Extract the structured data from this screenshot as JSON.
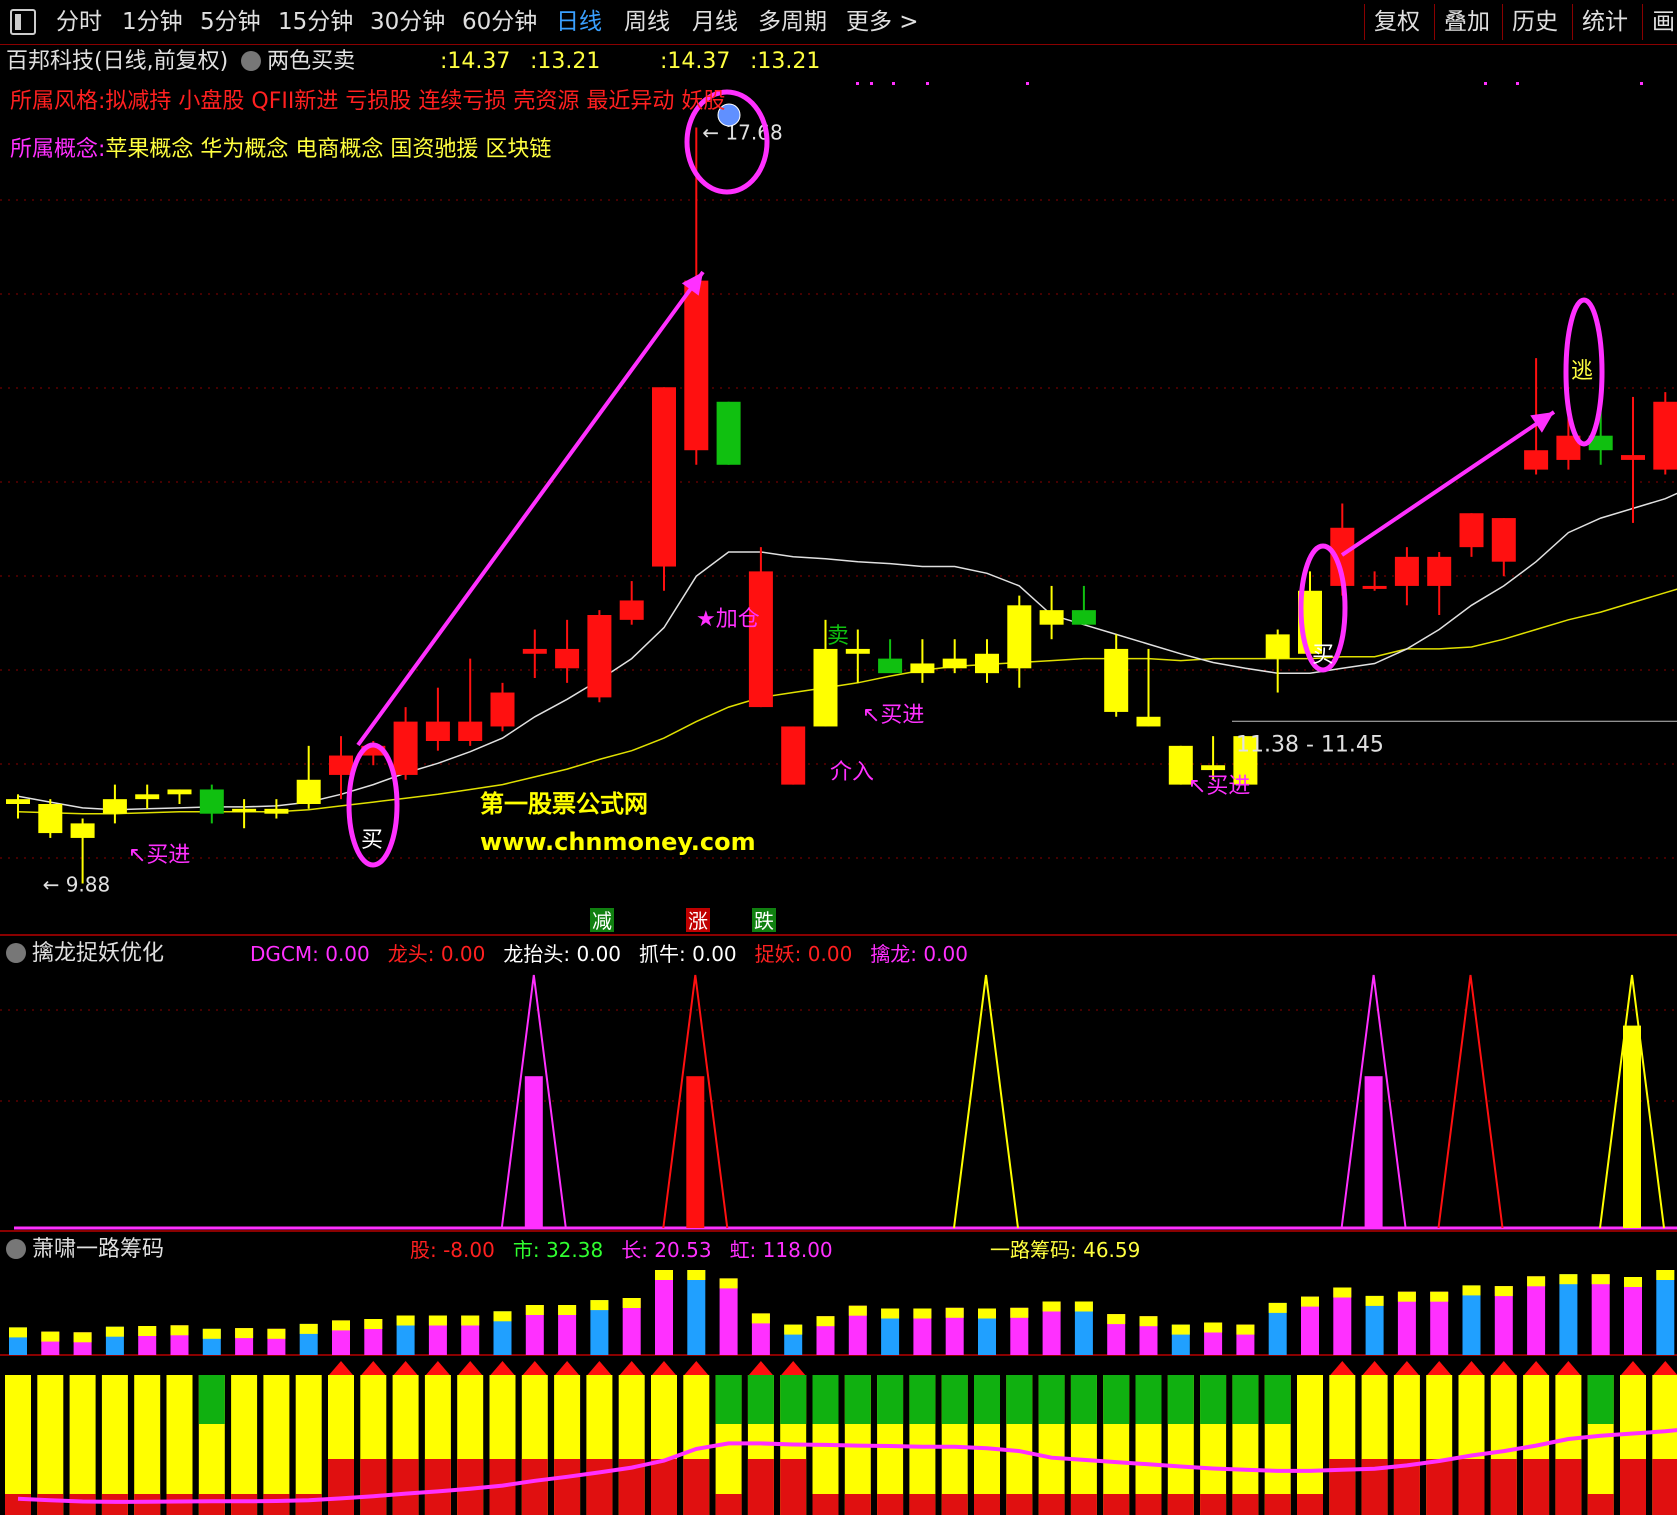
{
  "toolbar": {
    "periods": [
      {
        "label": "分时",
        "active": false
      },
      {
        "label": "1分钟",
        "active": false
      },
      {
        "label": "5分钟",
        "active": false
      },
      {
        "label": "15分钟",
        "active": false
      },
      {
        "label": "30分钟",
        "active": false
      },
      {
        "label": "60分钟",
        "active": false
      },
      {
        "label": "日线",
        "active": true
      },
      {
        "label": "周线",
        "active": false
      },
      {
        "label": "月线",
        "active": false
      },
      {
        "label": "多周期",
        "active": false
      },
      {
        "label": "更多 >",
        "active": false
      }
    ],
    "right": [
      "复权",
      "叠加",
      "历史",
      "统计",
      "画"
    ]
  },
  "main": {
    "title": "百邦科技(日线,前复权)",
    "indicator": "两色买卖",
    "values": [
      ":14.37",
      ":13.21",
      ":14.37",
      ":13.21"
    ],
    "style_label": "所属风格:",
    "style_text": "拟减持 小盘股 QFII新进 亏损股 连续亏损 壳资源 最近异动 妖股",
    "concept_label": "所属概念:",
    "concept_text": "苹果概念 华为概念 电商概念 国资驰援 区块链",
    "watermark_1": "第一股票公式网",
    "watermark_2": "www.chnmoney.com",
    "high_label": "17.68",
    "low_label": "9.88",
    "range_box": "11.38 - 11.45",
    "markers": {
      "buy": "买",
      "buy_in": "买进",
      "sell": "卖",
      "enter": "介入",
      "escape": "逃",
      "add": "加仓",
      "star": "★",
      "decrease": "减",
      "rise": "涨",
      "fall": "跌"
    }
  },
  "panel2": {
    "name": "擒龙捉妖优化",
    "labels": [
      {
        "name": "DGCM",
        "value": "0.00",
        "color": "#ff30ff"
      },
      {
        "name": "龙头",
        "value": "0.00",
        "color": "#ff2020"
      },
      {
        "name": "龙抬头",
        "value": "0.00",
        "color": "#ffffff"
      },
      {
        "name": "抓牛",
        "value": "0.00",
        "color": "#ffffff"
      },
      {
        "name": "捉妖",
        "value": "0.00",
        "color": "#ff2020"
      },
      {
        "name": "擒龙",
        "value": "0.00",
        "color": "#ff30ff"
      }
    ]
  },
  "panel3": {
    "name": "萧啸一路筹码",
    "labels": [
      {
        "name": "股",
        "value": "-8.00",
        "color": "#ff2020"
      },
      {
        "name": "市",
        "value": "32.38",
        "color": "#30ff30"
      },
      {
        "name": "长",
        "value": "20.53",
        "color": "#ff30ff"
      },
      {
        "name": "虹",
        "value": "118.00",
        "color": "#ff30ff"
      }
    ],
    "chip_label": "一路筹码",
    "chip_value": "46.59"
  },
  "colors": {
    "up": "#ff1010",
    "down_yellow": "#ffff00",
    "green": "#10c010",
    "magenta": "#ff30ff",
    "grid": "#8a0000",
    "ma_white": "#e0e0e0",
    "ma_yellow": "#e0e000"
  },
  "chart_data": {
    "type": "candlestick",
    "price_range": [
      9.4,
      18.5
    ],
    "candles": [
      {
        "o": 10.75,
        "h": 10.8,
        "l": 10.55,
        "c": 10.7,
        "color": "yellow"
      },
      {
        "o": 10.7,
        "h": 10.75,
        "l": 10.35,
        "c": 10.4,
        "color": "yellow"
      },
      {
        "o": 10.5,
        "h": 10.55,
        "l": 9.88,
        "c": 10.35,
        "color": "yellow"
      },
      {
        "o": 10.6,
        "h": 10.9,
        "l": 10.5,
        "c": 10.75,
        "color": "yellow"
      },
      {
        "o": 10.75,
        "h": 10.9,
        "l": 10.65,
        "c": 10.8,
        "color": "yellow"
      },
      {
        "o": 10.8,
        "h": 10.85,
        "l": 10.7,
        "c": 10.85,
        "color": "yellow"
      },
      {
        "o": 10.85,
        "h": 10.9,
        "l": 10.5,
        "c": 10.6,
        "color": "green"
      },
      {
        "o": 10.65,
        "h": 10.75,
        "l": 10.45,
        "c": 10.65,
        "color": "yellow"
      },
      {
        "o": 10.65,
        "h": 10.75,
        "l": 10.55,
        "c": 10.6,
        "color": "yellow"
      },
      {
        "o": 10.7,
        "h": 11.3,
        "l": 10.65,
        "c": 10.95,
        "color": "yellow"
      },
      {
        "o": 11.0,
        "h": 11.4,
        "l": 10.75,
        "c": 11.2,
        "color": "red"
      },
      {
        "o": 11.2,
        "h": 11.35,
        "l": 11.1,
        "c": 11.3,
        "color": "red"
      },
      {
        "o": 11.0,
        "h": 11.7,
        "l": 10.95,
        "c": 11.55,
        "color": "red"
      },
      {
        "o": 11.35,
        "h": 11.9,
        "l": 11.25,
        "c": 11.55,
        "color": "red"
      },
      {
        "o": 11.35,
        "h": 12.2,
        "l": 11.3,
        "c": 11.55,
        "color": "red"
      },
      {
        "o": 11.5,
        "h": 11.95,
        "l": 11.45,
        "c": 11.85,
        "color": "red"
      },
      {
        "o": 12.25,
        "h": 12.5,
        "l": 12.0,
        "c": 12.3,
        "color": "red"
      },
      {
        "o": 12.1,
        "h": 12.6,
        "l": 11.95,
        "c": 12.3,
        "color": "red"
      },
      {
        "o": 11.8,
        "h": 12.7,
        "l": 11.75,
        "c": 12.65,
        "color": "red"
      },
      {
        "o": 12.6,
        "h": 13.0,
        "l": 12.55,
        "c": 12.8,
        "color": "red"
      },
      {
        "o": 13.15,
        "h": 15.0,
        "l": 12.9,
        "c": 15.0,
        "color": "red"
      },
      {
        "o": 14.35,
        "h": 17.68,
        "l": 14.2,
        "c": 16.1,
        "color": "red"
      },
      {
        "o": 14.85,
        "h": 14.85,
        "l": 14.2,
        "c": 14.2,
        "color": "green"
      },
      {
        "o": 13.1,
        "h": 13.35,
        "l": 11.7,
        "c": 11.7,
        "color": "red"
      },
      {
        "o": 11.5,
        "h": 11.5,
        "l": 10.9,
        "c": 10.9,
        "color": "red"
      },
      {
        "o": 12.3,
        "h": 12.6,
        "l": 11.5,
        "c": 11.5,
        "color": "yellow"
      },
      {
        "o": 12.3,
        "h": 12.5,
        "l": 11.95,
        "c": 12.25,
        "color": "yellow"
      },
      {
        "o": 12.2,
        "h": 12.4,
        "l": 12.1,
        "c": 12.05,
        "color": "green"
      },
      {
        "o": 12.15,
        "h": 12.4,
        "l": 11.95,
        "c": 12.05,
        "color": "yellow"
      },
      {
        "o": 12.2,
        "h": 12.4,
        "l": 12.05,
        "c": 12.1,
        "color": "yellow"
      },
      {
        "o": 12.25,
        "h": 12.4,
        "l": 11.95,
        "c": 12.05,
        "color": "yellow"
      },
      {
        "o": 12.75,
        "h": 12.85,
        "l": 11.9,
        "c": 12.1,
        "color": "yellow"
      },
      {
        "o": 12.7,
        "h": 12.95,
        "l": 12.4,
        "c": 12.55,
        "color": "yellow"
      },
      {
        "o": 12.7,
        "h": 12.95,
        "l": 12.55,
        "c": 12.55,
        "color": "green"
      },
      {
        "o": 12.3,
        "h": 12.45,
        "l": 11.6,
        "c": 11.65,
        "color": "yellow"
      },
      {
        "o": 11.6,
        "h": 12.3,
        "l": 11.5,
        "c": 11.5,
        "color": "yellow"
      },
      {
        "o": 11.3,
        "h": 11.3,
        "l": 10.9,
        "c": 10.9,
        "color": "yellow"
      },
      {
        "o": 11.1,
        "h": 11.4,
        "l": 10.95,
        "c": 11.05,
        "color": "yellow"
      },
      {
        "o": 11.4,
        "h": 11.4,
        "l": 10.9,
        "c": 10.9,
        "color": "yellow"
      },
      {
        "o": 12.2,
        "h": 12.5,
        "l": 11.85,
        "c": 12.45,
        "color": "yellow"
      },
      {
        "o": 12.25,
        "h": 13.1,
        "l": 12.2,
        "c": 12.9,
        "color": "yellow"
      },
      {
        "o": 12.95,
        "h": 13.8,
        "l": 12.85,
        "c": 13.55,
        "color": "red"
      },
      {
        "o": 12.95,
        "h": 13.1,
        "l": 12.9,
        "c": 12.95,
        "color": "red"
      },
      {
        "o": 12.95,
        "h": 13.35,
        "l": 12.75,
        "c": 13.25,
        "color": "red"
      },
      {
        "o": 12.95,
        "h": 13.3,
        "l": 12.65,
        "c": 13.25,
        "color": "red"
      },
      {
        "o": 13.35,
        "h": 13.7,
        "l": 13.25,
        "c": 13.7,
        "color": "red"
      },
      {
        "o": 13.2,
        "h": 13.65,
        "l": 13.05,
        "c": 13.65,
        "color": "red"
      },
      {
        "o": 14.15,
        "h": 15.3,
        "l": 14.1,
        "c": 14.35,
        "color": "red"
      },
      {
        "o": 14.25,
        "h": 14.9,
        "l": 14.15,
        "c": 14.5,
        "color": "red"
      },
      {
        "o": 14.35,
        "h": 14.8,
        "l": 14.2,
        "c": 14.5,
        "color": "green"
      },
      {
        "o": 14.25,
        "h": 14.9,
        "l": 13.6,
        "c": 14.3,
        "color": "red"
      },
      {
        "o": 14.15,
        "h": 14.95,
        "l": 14.1,
        "c": 14.85,
        "color": "red"
      },
      {
        "o": 14.9,
        "h": 15.4,
        "l": 14.8,
        "c": 15.35,
        "color": "red"
      }
    ],
    "ma_white": [
      10.78,
      10.72,
      10.66,
      10.64,
      10.65,
      10.66,
      10.67,
      10.67,
      10.68,
      10.72,
      10.8,
      10.9,
      11.02,
      11.12,
      11.24,
      11.38,
      11.6,
      11.78,
      11.98,
      12.2,
      12.52,
      13.05,
      13.3,
      13.3,
      13.25,
      13.23,
      13.2,
      13.18,
      13.15,
      13.15,
      13.08,
      12.95,
      12.65,
      12.55,
      12.45,
      12.35,
      12.25,
      12.16,
      12.1,
      12.05,
      12.05,
      12.1,
      12.15,
      12.3,
      12.5,
      12.75,
      12.95,
      13.2,
      13.5,
      13.65,
      13.75,
      13.85,
      14.0
    ],
    "ma_yellow": [
      10.62,
      10.61,
      10.6,
      10.6,
      10.61,
      10.62,
      10.62,
      10.62,
      10.62,
      10.64,
      10.68,
      10.72,
      10.76,
      10.8,
      10.85,
      10.9,
      10.98,
      11.06,
      11.16,
      11.25,
      11.38,
      11.55,
      11.7,
      11.8,
      11.85,
      11.9,
      11.95,
      12.02,
      12.08,
      12.12,
      12.14,
      12.16,
      12.18,
      12.2,
      12.2,
      12.2,
      12.18,
      12.2,
      12.2,
      12.2,
      12.2,
      12.22,
      12.22,
      12.3,
      12.3,
      12.32,
      12.4,
      12.5,
      12.6,
      12.68,
      12.78,
      12.88,
      12.98
    ],
    "panel2_spikes": [
      {
        "index": 16,
        "color": "magenta",
        "bar": 0.6
      },
      {
        "index": 21,
        "color": "red",
        "bar": 0.6
      },
      {
        "index": 30,
        "color": "yellow",
        "bar": 0
      },
      {
        "index": 42,
        "color": "magenta",
        "bar": 0.6
      },
      {
        "index": 45,
        "color": "red",
        "bar": 0
      },
      {
        "index": 50,
        "color": "yellow",
        "bar": 0.8
      }
    ]
  }
}
